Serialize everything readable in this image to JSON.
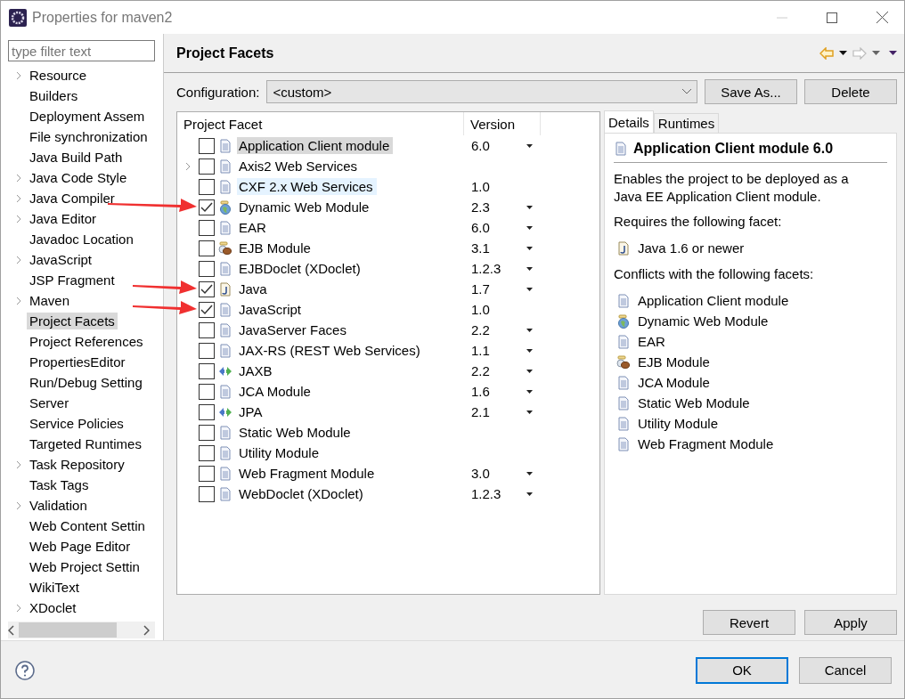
{
  "window": {
    "title": "Properties for maven2"
  },
  "sidebar": {
    "filter": {
      "placeholder": "type filter text"
    },
    "items": [
      {
        "label": "Resource",
        "expandable": true,
        "selected": false
      },
      {
        "label": "Builders",
        "expandable": false,
        "selected": false
      },
      {
        "label": "Deployment Assem",
        "expandable": false,
        "selected": false
      },
      {
        "label": "File synchronization",
        "expandable": false,
        "selected": false
      },
      {
        "label": "Java Build Path",
        "expandable": false,
        "selected": false
      },
      {
        "label": "Java Code Style",
        "expandable": true,
        "selected": false
      },
      {
        "label": "Java Compiler",
        "expandable": true,
        "selected": false
      },
      {
        "label": "Java Editor",
        "expandable": true,
        "selected": false
      },
      {
        "label": "Javadoc Location",
        "expandable": false,
        "selected": false
      },
      {
        "label": "JavaScript",
        "expandable": true,
        "selected": false
      },
      {
        "label": "JSP Fragment",
        "expandable": false,
        "selected": false
      },
      {
        "label": "Maven",
        "expandable": true,
        "selected": false
      },
      {
        "label": "Project Facets",
        "expandable": false,
        "selected": true
      },
      {
        "label": "Project References",
        "expandable": false,
        "selected": false
      },
      {
        "label": "PropertiesEditor",
        "expandable": false,
        "selected": false
      },
      {
        "label": "Run/Debug Setting",
        "expandable": false,
        "selected": false
      },
      {
        "label": "Server",
        "expandable": false,
        "selected": false
      },
      {
        "label": "Service Policies",
        "expandable": false,
        "selected": false
      },
      {
        "label": "Targeted Runtimes",
        "expandable": false,
        "selected": false
      },
      {
        "label": "Task Repository",
        "expandable": true,
        "selected": false
      },
      {
        "label": "Task Tags",
        "expandable": false,
        "selected": false
      },
      {
        "label": "Validation",
        "expandable": true,
        "selected": false
      },
      {
        "label": "Web Content Settin",
        "expandable": false,
        "selected": false
      },
      {
        "label": "Web Page Editor",
        "expandable": false,
        "selected": false
      },
      {
        "label": "Web Project Settin",
        "expandable": false,
        "selected": false
      },
      {
        "label": "WikiText",
        "expandable": false,
        "selected": false
      },
      {
        "label": "XDoclet",
        "expandable": true,
        "selected": false
      }
    ]
  },
  "page": {
    "title": "Project Facets",
    "configuration": {
      "label": "Configuration:",
      "value": "<custom>"
    },
    "buttons": [
      "Save As...",
      "Delete"
    ]
  },
  "facets": {
    "columns": [
      "Project Facet",
      "Version"
    ],
    "rows": [
      {
        "name": "Application Client module",
        "kind": "doc",
        "version": "6.0",
        "has_versions": true,
        "checked": false,
        "expandable": false,
        "selected": true,
        "hovered": false,
        "marked": false
      },
      {
        "name": "Axis2 Web Services",
        "kind": "doc",
        "has_versions": false,
        "checked": false,
        "expandable": true,
        "selected": false,
        "hovered": false,
        "marked": false
      },
      {
        "name": "CXF 2.x Web Services",
        "kind": "doc",
        "version": "1.0",
        "has_versions": false,
        "checked": false,
        "expandable": false,
        "selected": false,
        "hovered": true,
        "marked": false
      },
      {
        "name": "Dynamic Web Module",
        "kind": "globe",
        "version": "2.3",
        "has_versions": true,
        "checked": true,
        "expandable": false,
        "selected": false,
        "hovered": false,
        "marked": true
      },
      {
        "name": "EAR",
        "kind": "doc",
        "version": "6.0",
        "has_versions": true,
        "checked": false,
        "expandable": false,
        "selected": false,
        "hovered": false,
        "marked": false
      },
      {
        "name": "EJB Module",
        "kind": "bean",
        "version": "3.1",
        "has_versions": true,
        "checked": false,
        "expandable": false,
        "selected": false,
        "hovered": false,
        "marked": false
      },
      {
        "name": "EJBDoclet (XDoclet)",
        "kind": "doc",
        "version": "1.2.3",
        "has_versions": true,
        "checked": false,
        "expandable": false,
        "selected": false,
        "hovered": false,
        "marked": false
      },
      {
        "name": "Java",
        "kind": "java",
        "version": "1.7",
        "has_versions": true,
        "checked": true,
        "expandable": false,
        "selected": false,
        "hovered": false,
        "marked": true
      },
      {
        "name": "JavaScript",
        "kind": "doc",
        "version": "1.0",
        "has_versions": false,
        "checked": true,
        "expandable": false,
        "selected": false,
        "hovered": false,
        "marked": true
      },
      {
        "name": "JavaServer Faces",
        "kind": "doc",
        "version": "2.2",
        "has_versions": true,
        "checked": false,
        "expandable": false,
        "selected": false,
        "hovered": false,
        "marked": false
      },
      {
        "name": "JAX-RS (REST Web Services)",
        "kind": "doc",
        "version": "1.1",
        "has_versions": true,
        "checked": false,
        "expandable": false,
        "selected": false,
        "hovered": false,
        "marked": false
      },
      {
        "name": "JAXB",
        "kind": "arrows",
        "version": "2.2",
        "has_versions": true,
        "checked": false,
        "expandable": false,
        "selected": false,
        "hovered": false,
        "marked": false
      },
      {
        "name": "JCA Module",
        "kind": "doc",
        "version": "1.6",
        "has_versions": true,
        "checked": false,
        "expandable": false,
        "selected": false,
        "hovered": false,
        "marked": false
      },
      {
        "name": "JPA",
        "kind": "arrows",
        "version": "2.1",
        "has_versions": true,
        "checked": false,
        "expandable": false,
        "selected": false,
        "hovered": false,
        "marked": false
      },
      {
        "name": "Static Web Module",
        "kind": "doc",
        "has_versions": false,
        "checked": false,
        "expandable": false,
        "selected": false,
        "hovered": false,
        "marked": false
      },
      {
        "name": "Utility Module",
        "kind": "doc",
        "has_versions": false,
        "checked": false,
        "expandable": false,
        "selected": false,
        "hovered": false,
        "marked": false
      },
      {
        "name": "Web Fragment Module",
        "kind": "doc",
        "version": "3.0",
        "has_versions": true,
        "checked": false,
        "expandable": false,
        "selected": false,
        "hovered": false,
        "marked": false
      },
      {
        "name": "WebDoclet (XDoclet)",
        "kind": "doc",
        "version": "1.2.3",
        "has_versions": true,
        "checked": false,
        "expandable": false,
        "selected": false,
        "hovered": false,
        "marked": false
      }
    ]
  },
  "details": {
    "tabs": [
      {
        "label": "Details",
        "selected": true
      },
      {
        "label": "Runtimes",
        "selected": false
      }
    ],
    "title": {
      "text": "Application Client module 6.0",
      "kind": "doc"
    },
    "description": "Enables the project to be deployed as a Java EE Application Client module.",
    "requires_label": "Requires the following facet:",
    "requires": [
      {
        "label": "Java 1.6 or newer",
        "kind": "java"
      }
    ],
    "conflicts_label": "Conflicts with the following facets:",
    "conflicts": [
      {
        "label": "Application Client module",
        "kind": "doc"
      },
      {
        "label": "Dynamic Web Module",
        "kind": "globe"
      },
      {
        "label": "EAR",
        "kind": "doc"
      },
      {
        "label": "EJB Module",
        "kind": "bean"
      },
      {
        "label": "JCA Module",
        "kind": "doc"
      },
      {
        "label": "Static Web Module",
        "kind": "doc"
      },
      {
        "label": "Utility Module",
        "kind": "doc"
      },
      {
        "label": "Web Fragment Module",
        "kind": "doc"
      }
    ]
  },
  "actions": [
    "Revert",
    "Apply"
  ],
  "dialog_buttons": [
    "OK",
    "Cancel"
  ]
}
